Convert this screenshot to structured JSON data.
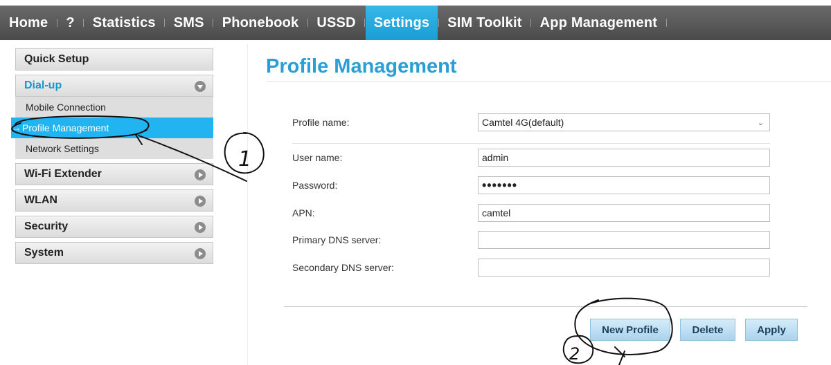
{
  "nav": {
    "items": [
      {
        "label": "Home",
        "active": false
      },
      {
        "label": "?",
        "active": false
      },
      {
        "label": "Statistics",
        "active": false
      },
      {
        "label": "SMS",
        "active": false
      },
      {
        "label": "Phonebook",
        "active": false
      },
      {
        "label": "USSD",
        "active": false
      },
      {
        "label": "Settings",
        "active": true
      },
      {
        "label": "SIM Toolkit",
        "active": false
      },
      {
        "label": "App Management",
        "active": false
      }
    ]
  },
  "sidebar": {
    "quick_setup": "Quick Setup",
    "dialup": {
      "label": "Dial-up",
      "items": [
        "Mobile Connection",
        "Profile Management",
        "Network Settings"
      ],
      "selected": "Profile Management"
    },
    "wifi_extender": "Wi-Fi Extender",
    "wlan": "WLAN",
    "security": "Security",
    "system": "System"
  },
  "main": {
    "title": "Profile Management",
    "profile_name": {
      "label": "Profile name:",
      "value": "Camtel 4G(default)"
    },
    "user_name": {
      "label": "User name:",
      "value": "admin"
    },
    "password": {
      "label": "Password:",
      "value": "•••••••"
    },
    "apn": {
      "label": "APN:",
      "value": "camtel"
    },
    "primary_dns": {
      "label": "Primary DNS server:",
      "value": ""
    },
    "secondary_dns": {
      "label": "Secondary DNS server:",
      "value": ""
    },
    "buttons": {
      "new_profile": "New Profile",
      "delete": "Delete",
      "apply": "Apply"
    }
  },
  "annotations": {
    "step1": "1",
    "step2": "2"
  },
  "colors": {
    "accent": "#2a9fd6",
    "active_tab": "#1a9dd4",
    "selected_item": "#21b4f0"
  }
}
